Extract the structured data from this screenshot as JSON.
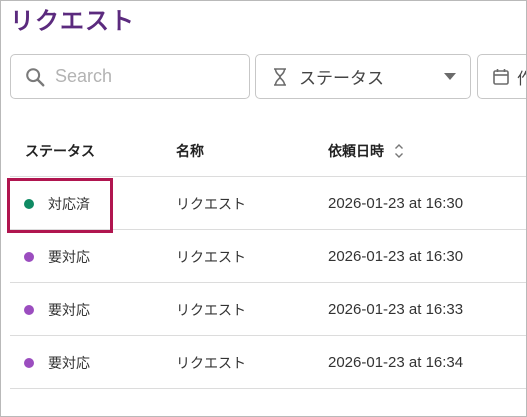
{
  "page": {
    "title": "リクエスト"
  },
  "filters": {
    "search_placeholder": "Search",
    "search_value": "",
    "status_label": "ステータス",
    "date_label": "作"
  },
  "table": {
    "headers": {
      "status": "ステータス",
      "name": "名称",
      "date": "依頼日時"
    },
    "rows": [
      {
        "status": "対応済",
        "status_color": "#0e8a63",
        "name": "リクエスト",
        "date": "2026-01-23 at 16:30"
      },
      {
        "status": "要対応",
        "status_color": "#9b4dbf",
        "name": "リクエスト",
        "date": "2026-01-23 at 16:30"
      },
      {
        "status": "要対応",
        "status_color": "#9b4dbf",
        "name": "リクエスト",
        "date": "2026-01-23 at 16:33"
      },
      {
        "status": "要対応",
        "status_color": "#9b4dbf",
        "name": "リクエスト",
        "date": "2026-01-23 at 16:34"
      }
    ]
  },
  "colors": {
    "title": "#5b2a7e",
    "highlight": "#b0154f"
  },
  "icons": {
    "search": "search-icon",
    "status": "hourglass-icon",
    "dropdown": "caret-down-icon",
    "date": "calendar-icon",
    "sort": "sort-icon"
  }
}
